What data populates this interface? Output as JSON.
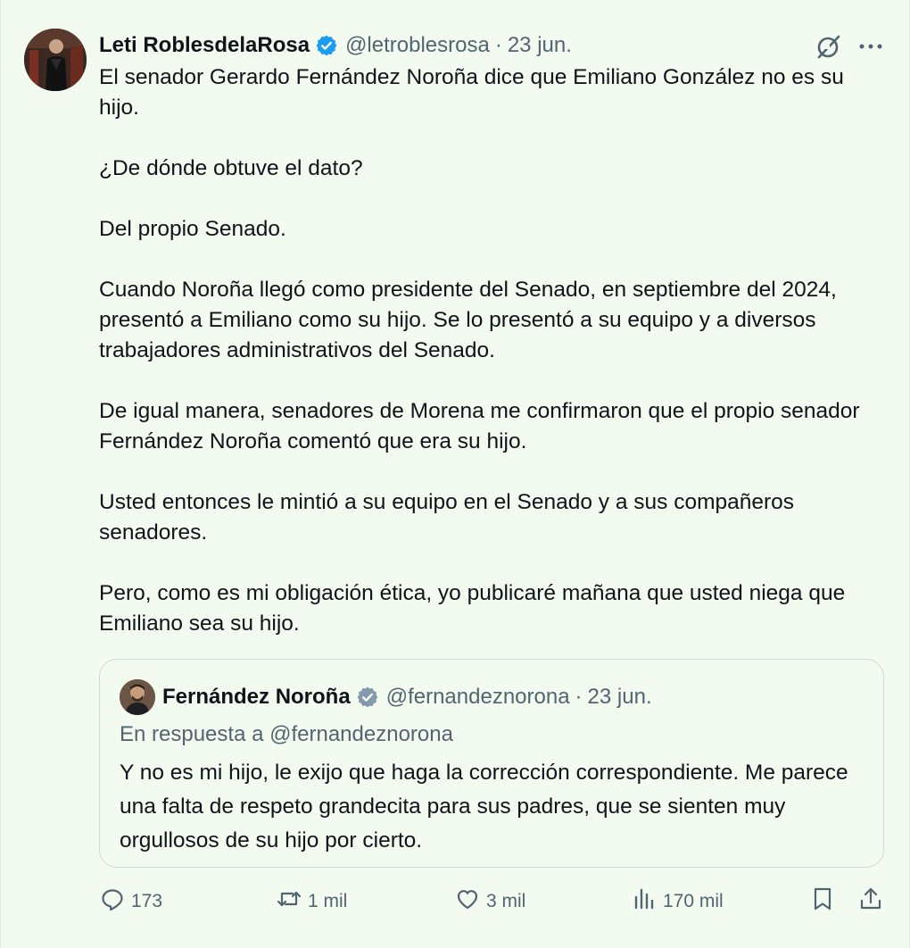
{
  "author": {
    "display_name": "Leti RoblesdelaRosa",
    "handle": "@letroblesrosa",
    "separator": "·",
    "date": "23 jun."
  },
  "tweet_paragraphs": [
    "El senador Gerardo Fernández Noroña dice que Emiliano González no es su hijo.",
    "¿De dónde obtuve el dato?",
    "Del propio Senado.",
    "Cuando Noroña llegó como presidente del Senado, en septiembre del 2024, presentó a Emiliano como su hijo. Se lo presentó a su equipo y a diversos trabajadores administrativos del Senado.",
    "De igual manera, senadores de Morena me confirmaron que el propio senador Fernández Noroña comentó que era su hijo.",
    "Usted entonces le mintió a su equipo en el Senado y a sus compañeros senadores.",
    "Pero, como es mi obligación ética, yo publicaré mañana que usted niega que Emiliano sea su hijo."
  ],
  "quoted": {
    "display_name": "Fernández Noroña",
    "handle": "@fernandeznorona",
    "separator": "·",
    "date": "23 jun.",
    "replying_to": "En respuesta a @fernandeznorona",
    "text": "Y no es mi hijo, le exijo que haga la corrección correspondiente. Me parece una falta de respeto grandecita para sus padres, que se sienten muy orgullosos de su hijo por cierto."
  },
  "actions": {
    "replies": "173",
    "reposts": "1 mil",
    "likes": "3 mil",
    "views": "170 mil"
  },
  "icons": {
    "verified": "verified-badge-icon",
    "grok": "grok-icon",
    "more": "more-icon",
    "reply": "reply-icon",
    "repost": "repost-icon",
    "like": "heart-icon",
    "views": "views-icon",
    "bookmark": "bookmark-icon",
    "share": "share-icon"
  },
  "colors": {
    "background": "#f3fbf0",
    "text": "#0f1419",
    "secondary": "#536471",
    "verified": "#1d9bf0",
    "border": "#cfd9de"
  }
}
